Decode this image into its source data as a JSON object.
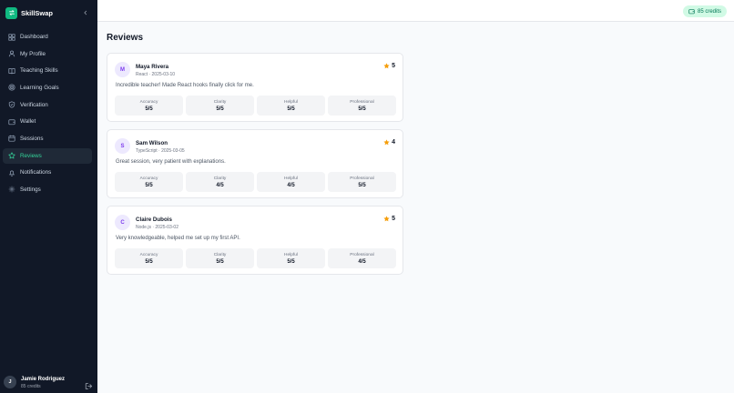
{
  "app": {
    "name": "SkillSwap"
  },
  "sidebar": {
    "items": [
      {
        "label": "Dashboard",
        "icon": "dashboard-icon",
        "active": false
      },
      {
        "label": "My Profile",
        "icon": "user-icon",
        "active": false
      },
      {
        "label": "Teaching Skills",
        "icon": "book-icon",
        "active": false
      },
      {
        "label": "Learning Goals",
        "icon": "target-icon",
        "active": false
      },
      {
        "label": "Verification",
        "icon": "shield-icon",
        "active": false
      },
      {
        "label": "Wallet",
        "icon": "wallet-icon",
        "active": false
      },
      {
        "label": "Sessions",
        "icon": "calendar-icon",
        "active": false
      },
      {
        "label": "Reviews",
        "icon": "star-icon",
        "active": true
      },
      {
        "label": "Notifications",
        "icon": "bell-icon",
        "active": false
      },
      {
        "label": "Settings",
        "icon": "gear-icon",
        "active": false
      }
    ]
  },
  "user": {
    "initial": "J",
    "name": "Jamie Rodriguez",
    "credits": "85 credits"
  },
  "topbar": {
    "credits": "85 credits"
  },
  "page": {
    "title": "Reviews"
  },
  "reviews": [
    {
      "initial": "M",
      "name": "Maya Rivera",
      "meta": "React · 2025-03-10",
      "rating": "5",
      "comment": "Incredible teacher! Made React hooks finally click for me.",
      "metrics": [
        {
          "label": "Accuracy",
          "value": "5/5"
        },
        {
          "label": "Clarity",
          "value": "5/5"
        },
        {
          "label": "Helpful",
          "value": "5/5"
        },
        {
          "label": "Professional",
          "value": "5/5"
        }
      ]
    },
    {
      "initial": "S",
      "name": "Sam Wilson",
      "meta": "TypeScript · 2025-03-05",
      "rating": "4",
      "comment": "Great session, very patient with explanations.",
      "metrics": [
        {
          "label": "Accuracy",
          "value": "5/5"
        },
        {
          "label": "Clarity",
          "value": "4/5"
        },
        {
          "label": "Helpful",
          "value": "4/5"
        },
        {
          "label": "Professional",
          "value": "5/5"
        }
      ]
    },
    {
      "initial": "C",
      "name": "Claire Dubois",
      "meta": "Node.js · 2025-03-02",
      "rating": "5",
      "comment": "Very knowledgeable, helped me set up my first API.",
      "metrics": [
        {
          "label": "Accuracy",
          "value": "5/5"
        },
        {
          "label": "Clarity",
          "value": "5/5"
        },
        {
          "label": "Helpful",
          "value": "5/5"
        },
        {
          "label": "Professional",
          "value": "4/5"
        }
      ]
    }
  ],
  "colors": {
    "accent": "#10b981",
    "sidebar": "#111827",
    "star": "#f59e0b"
  }
}
